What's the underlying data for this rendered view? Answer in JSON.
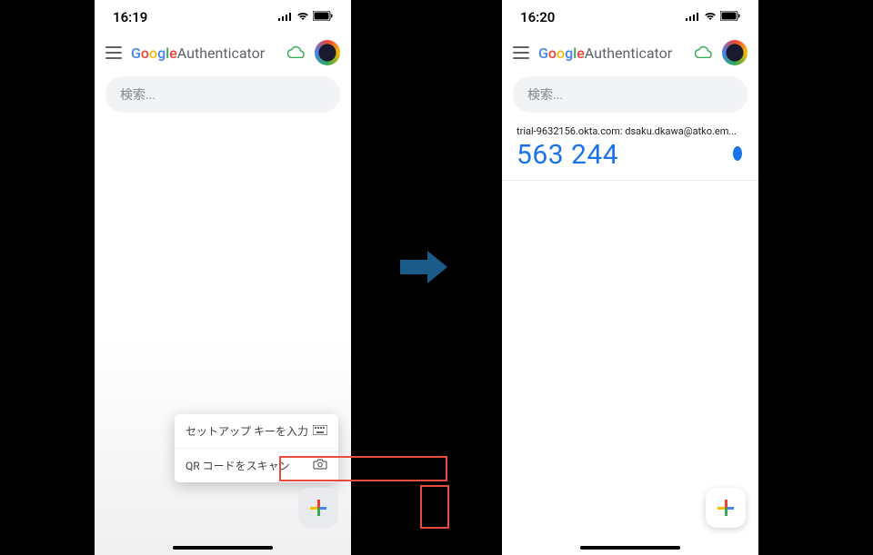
{
  "left": {
    "status": {
      "time": "16:19",
      "signal": "•ıl",
      "wifi": "wifi",
      "battery": "batt"
    },
    "header": {
      "google": {
        "g1": "G",
        "o1": "o",
        "o2": "o",
        "g2": "g",
        "l": "l",
        "e": "e"
      },
      "app_name": " Authenticator"
    },
    "search": {
      "placeholder": "検索..."
    },
    "fab_menu": {
      "items": [
        {
          "label": "セットアップ キーを入力",
          "icon": "keyboard"
        },
        {
          "label": "QR コードをスキャン",
          "icon": "camera"
        }
      ]
    }
  },
  "right": {
    "status": {
      "time": "16:20"
    },
    "header": {
      "google": {
        "g1": "G",
        "o1": "o",
        "o2": "o",
        "g2": "g",
        "l": "l",
        "e": "e"
      },
      "app_name": " Authenticator"
    },
    "search": {
      "placeholder": "検索..."
    },
    "account": {
      "label": "trial-9632156.okta.com: dsaku.dkawa@atko.em...",
      "code": "563 244"
    }
  }
}
